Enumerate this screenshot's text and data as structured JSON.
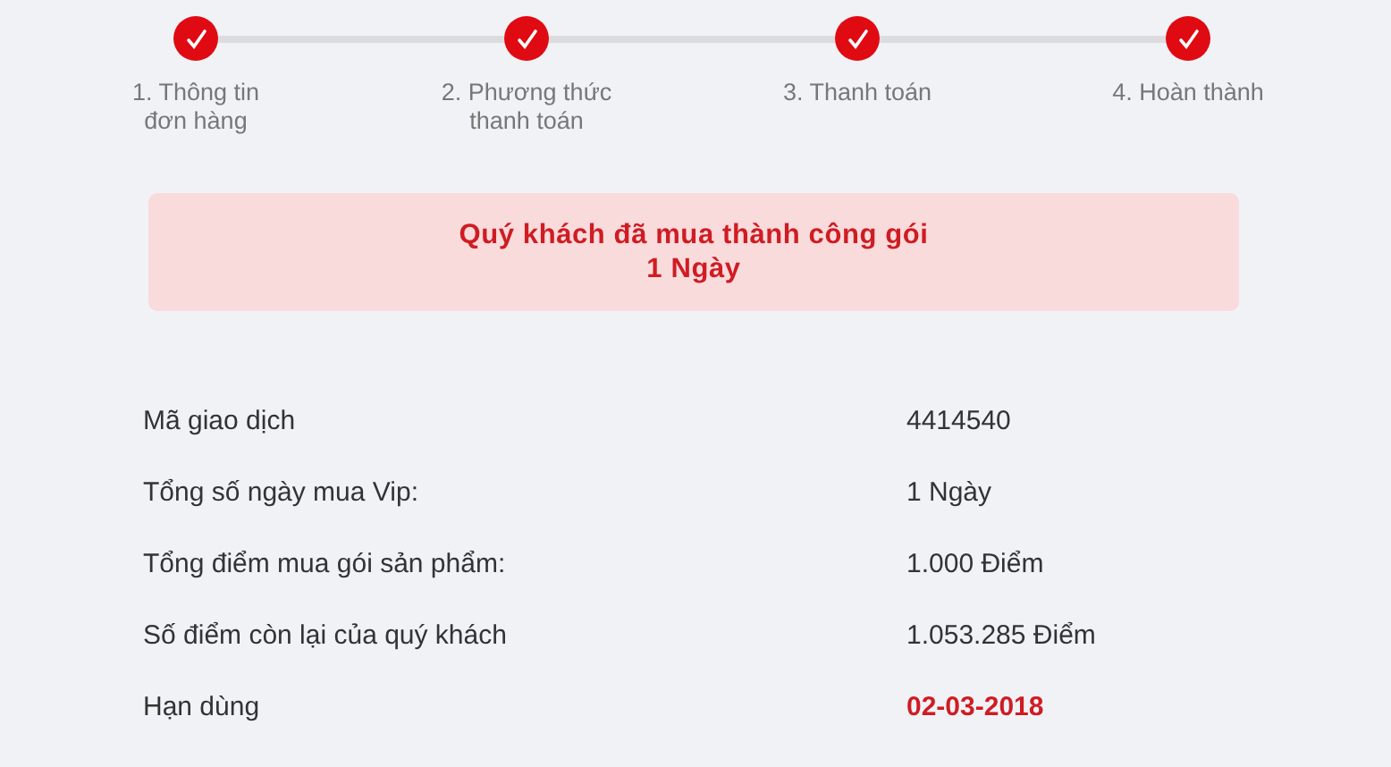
{
  "steps": [
    {
      "label": "1. Thông tin\nđơn hàng",
      "done": true
    },
    {
      "label": "2. Phương thức\nthanh toán",
      "done": true
    },
    {
      "label": "3. Thanh toán",
      "done": true
    },
    {
      "label": "4. Hoàn thành",
      "done": true
    }
  ],
  "banner": {
    "line_1": "Quý khách đã mua thành công gói",
    "line_2": "1 Ngày"
  },
  "details": [
    {
      "label": "Mã giao dịch",
      "value": "4414540",
      "emphasis": false
    },
    {
      "label": "Tổng số ngày mua Vip:",
      "value": "1 Ngày",
      "emphasis": false
    },
    {
      "label": "Tổng điểm mua gói sản phẩm:",
      "value": "1.000 Điểm",
      "emphasis": false
    },
    {
      "label": "Số điểm còn lại của quý khách",
      "value": "1.053.285 Điểm",
      "emphasis": false
    },
    {
      "label": "Hạn dùng",
      "value": "02-03-2018",
      "emphasis": true
    }
  ]
}
